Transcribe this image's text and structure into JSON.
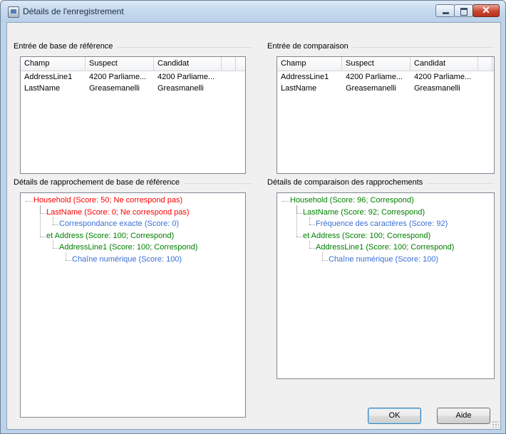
{
  "window": {
    "title": "Détails de l'enregistrement"
  },
  "colors": {
    "red": "#ff0000",
    "green": "#008000",
    "blue": "#3a6fd6"
  },
  "baseline_entry": {
    "group_label": "Entrée de base de référence",
    "columns": [
      "Champ",
      "Suspect",
      "Candidat"
    ],
    "rows": [
      [
        "AddressLine1",
        "4200 Parliame...",
        "4200 Parliame..."
      ],
      [
        "LastName",
        "Greasemanelli",
        "Greasmanelli"
      ]
    ]
  },
  "comparison_entry": {
    "group_label": "Entrée de comparaison",
    "columns": [
      "Champ",
      "Suspect",
      "Candidat"
    ],
    "rows": [
      [
        "AddressLine1",
        "4200 Parliame...",
        "4200 Parliame..."
      ],
      [
        "LastName",
        "Greasemanelli",
        "Greasmanelli"
      ]
    ]
  },
  "baseline_match": {
    "group_label": "Détails de rapprochement de base de référence",
    "nodes": [
      {
        "text": "Household (Score: 50; Ne correspond pas)",
        "level": 0,
        "color": "red"
      },
      {
        "text": "LastName (Score: 0; Ne correspond pas)",
        "level": 1,
        "color": "red"
      },
      {
        "text": "Correspondance exacte (Score: 0)",
        "level": 2,
        "color": "blue"
      },
      {
        "text": "et Address (Score: 100; Correspond)",
        "level": 1,
        "color": "green"
      },
      {
        "text": "AddressLine1 (Score: 100; Correspond)",
        "level": 2,
        "color": "green"
      },
      {
        "text": "Chaîne numérique (Score: 100)",
        "level": 3,
        "color": "blue"
      }
    ]
  },
  "comparison_match": {
    "group_label": "Détails de comparaison des rapprochements",
    "nodes": [
      {
        "text": "Household (Score: 96; Correspond)",
        "level": 0,
        "color": "green"
      },
      {
        "text": "LastName (Score: 92; Correspond)",
        "level": 1,
        "color": "green"
      },
      {
        "text": "Fréquence des caractères (Score: 92)",
        "level": 2,
        "color": "blue"
      },
      {
        "text": "et Address (Score: 100; Correspond)",
        "level": 1,
        "color": "green"
      },
      {
        "text": "AddressLine1 (Score: 100; Correspond)",
        "level": 2,
        "color": "green"
      },
      {
        "text": "Chaîne numérique (Score: 100)",
        "level": 3,
        "color": "blue"
      }
    ]
  },
  "buttons": {
    "ok": "OK",
    "help": "Aide"
  }
}
